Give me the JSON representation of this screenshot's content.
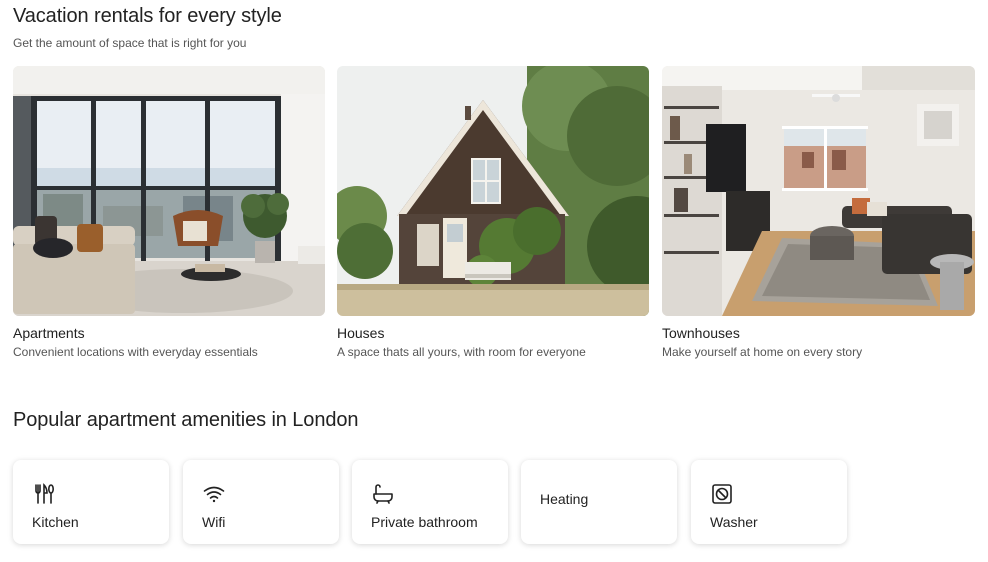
{
  "rentals": {
    "title": "Vacation rentals for every style",
    "subtitle": "Get the amount of space that is right for you",
    "cards": [
      {
        "name": "Apartments",
        "description": "Convenient locations with everyday essentials"
      },
      {
        "name": "Houses",
        "description": "A space thats all yours, with room for everyone"
      },
      {
        "name": "Townhouses",
        "description": "Make yourself at home on every story"
      }
    ]
  },
  "amenities": {
    "title": "Popular apartment amenities in London",
    "items": [
      {
        "label": "Kitchen",
        "icon": "kitchen-icon"
      },
      {
        "label": "Wifi",
        "icon": "wifi-icon"
      },
      {
        "label": "Private bathroom",
        "icon": "bathtub-icon"
      },
      {
        "label": "Heating",
        "icon": ""
      },
      {
        "label": "Washer",
        "icon": "washer-icon"
      }
    ]
  }
}
